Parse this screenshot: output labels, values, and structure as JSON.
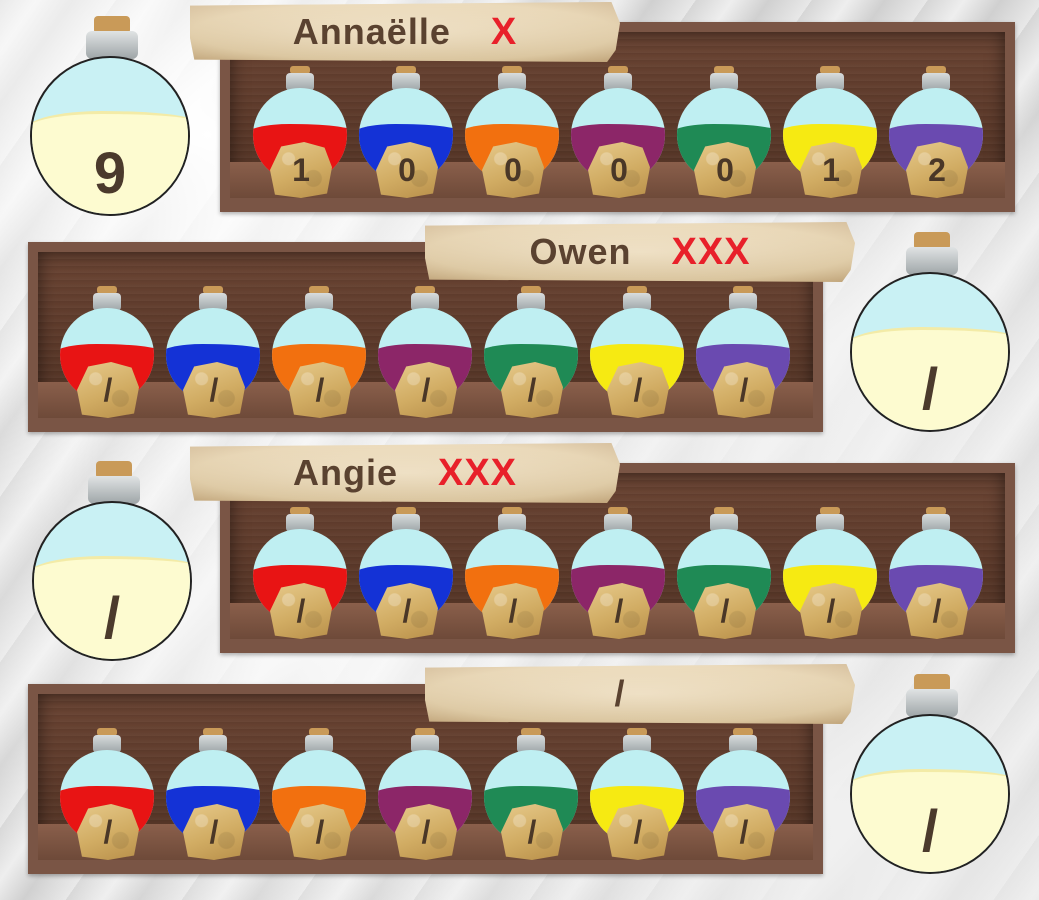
{
  "colors": {
    "potions": [
      "#e81414",
      "#1432d6",
      "#f2700f",
      "#8c2668",
      "#1f8a55",
      "#f6ea12",
      "#6a4ab0"
    ],
    "bead_text": "#4a3727",
    "mark_text": "#e8202a"
  },
  "rows": [
    {
      "name": "Annaëlle",
      "mark": "X",
      "total": "9",
      "potions": [
        "1",
        "0",
        "0",
        "0",
        "0",
        "1",
        "2"
      ]
    },
    {
      "name": "Owen",
      "mark": "XXX",
      "total": "/",
      "potions": [
        "/",
        "/",
        "/",
        "/",
        "/",
        "/",
        "/"
      ]
    },
    {
      "name": "Angie",
      "mark": "XXX",
      "total": "/",
      "potions": [
        "/",
        "/",
        "/",
        "/",
        "/",
        "/",
        "/"
      ]
    },
    {
      "name": "/",
      "mark": "",
      "total": "/",
      "potions": [
        "/",
        "/",
        "/",
        "/",
        "/",
        "/",
        "/"
      ]
    }
  ]
}
